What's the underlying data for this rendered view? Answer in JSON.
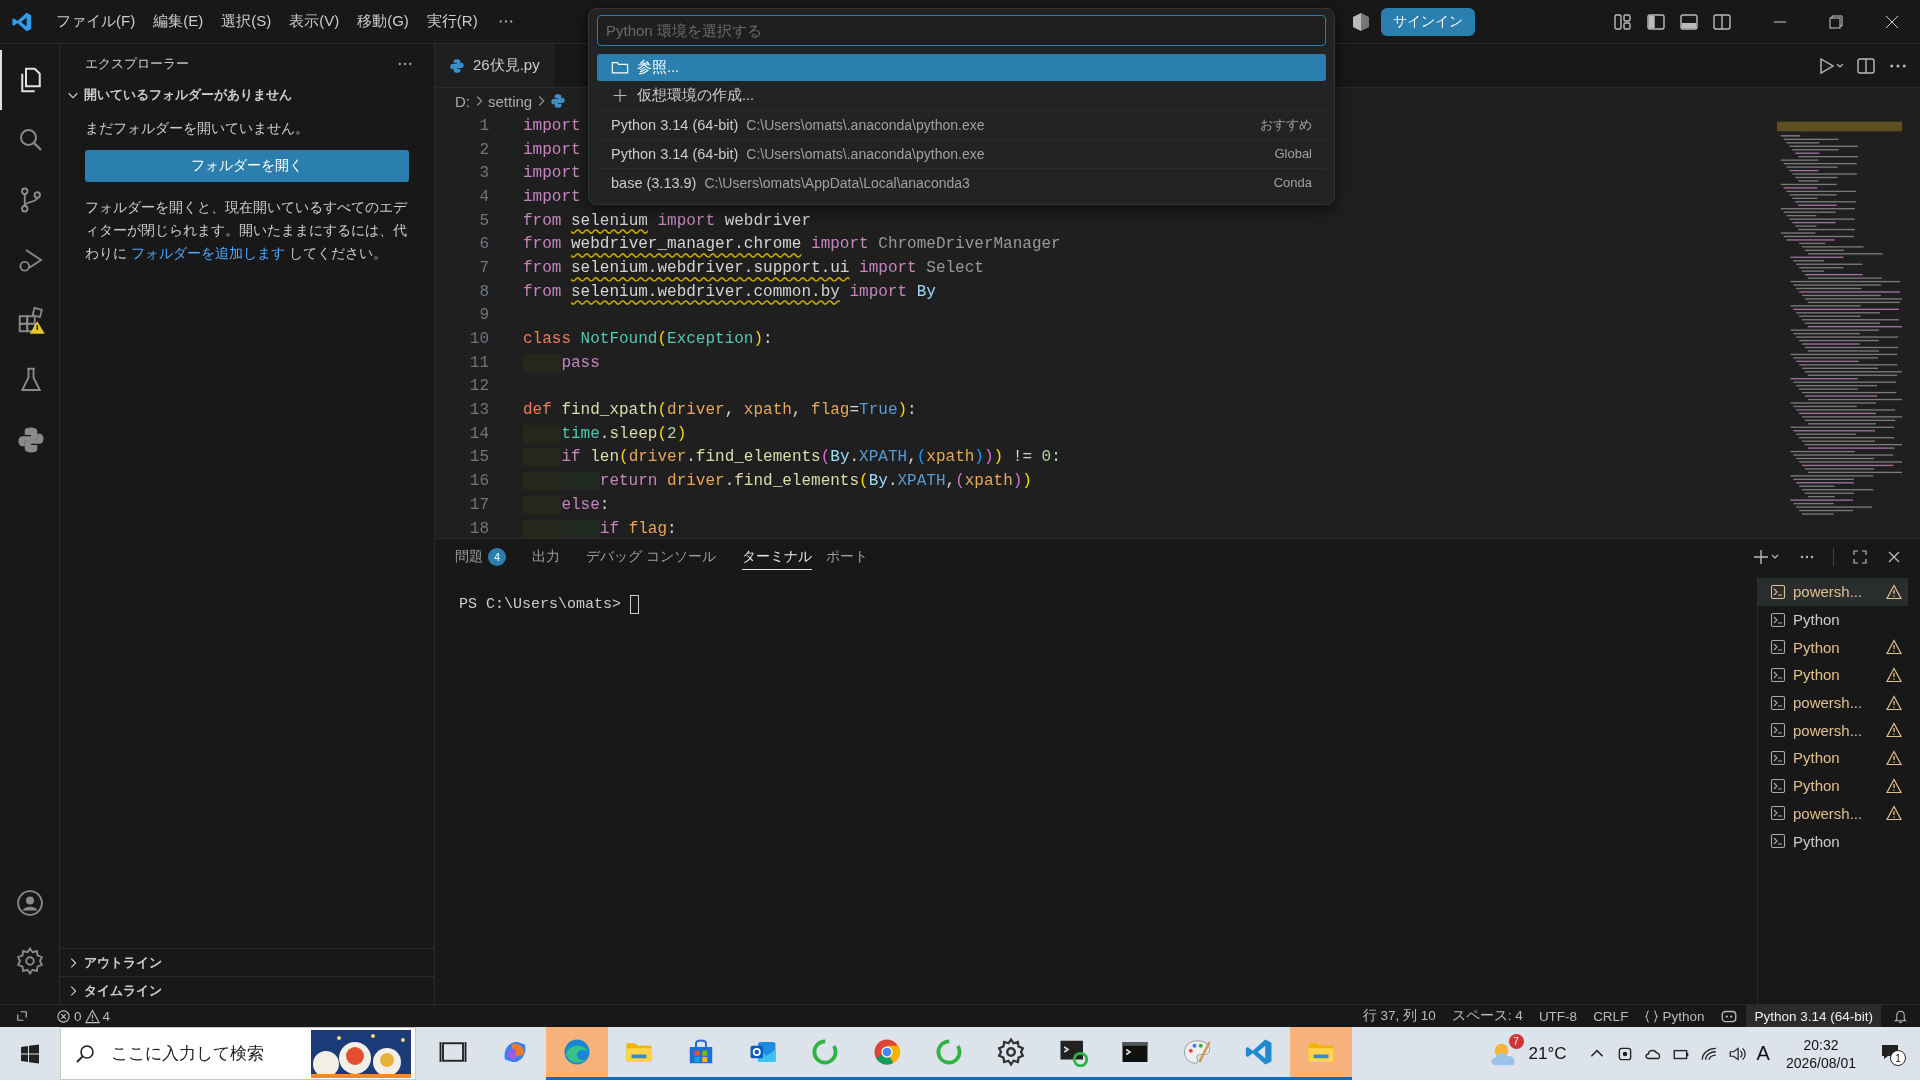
{
  "title_bar": {
    "menu": [
      "ファイル(F)",
      "編集(E)",
      "選択(S)",
      "表示(V)",
      "移動(G)",
      "実行(R)"
    ],
    "sign_in": "サインイン"
  },
  "quick_pick": {
    "placeholder": "Python 環境を選択する",
    "items": [
      {
        "kind": "browse",
        "label": "参照...",
        "selected": true
      },
      {
        "kind": "create",
        "label": "仮想環境の作成...",
        "selected": false
      },
      {
        "kind": "env",
        "label": "Python 3.14 (64-bit)",
        "detail": "C:\\Users\\omats\\.anaconda\\python.exe",
        "tag": "おすすめ",
        "selected": false
      },
      {
        "kind": "env",
        "label": "Python 3.14 (64-bit)",
        "detail": "C:\\Users\\omats\\.anaconda\\python.exe",
        "tag": "Global",
        "selected": false
      },
      {
        "kind": "env",
        "label": "base (3.13.9)",
        "detail": "C:\\Users\\omats\\AppData\\Local\\anaconda3",
        "tag": "Conda",
        "selected": false
      }
    ]
  },
  "activity_bar": [
    {
      "kind": "files",
      "selected": true
    },
    {
      "kind": "search",
      "selected": false
    },
    {
      "kind": "source",
      "selected": false
    },
    {
      "kind": "debug",
      "selected": false
    },
    {
      "kind": "extensions",
      "selected": false
    },
    {
      "kind": "testing",
      "selected": false
    },
    {
      "kind": "python",
      "selected": false
    }
  ],
  "sidebar": {
    "title": "エクスプローラー",
    "section": {
      "label": "開いているフォルダーがありません",
      "expanded": true
    },
    "message": "まだフォルダーを開いていません。",
    "button": "フォルダーを開く",
    "note_before": "フォルダーを開くと、現在開いているすべてのエディターが閉じられます。開いたままにするには、代わりに ",
    "note_link": "フォルダーを追加します",
    "note_after": " してください。",
    "bottom_sections": [
      {
        "label": "アウトライン",
        "expanded": false
      },
      {
        "label": "タイムライン",
        "expanded": false
      }
    ]
  },
  "editor": {
    "tab": "26伏見.py",
    "breadcrumb": [
      "D:",
      "setting"
    ],
    "lines": [
      {
        "n": "1",
        "tokens": [
          {
            "text": "import",
            "kind": "kw"
          }
        ]
      },
      {
        "n": "2",
        "tokens": [
          {
            "text": "import",
            "kind": "kw"
          }
        ]
      },
      {
        "n": "3",
        "tokens": [
          {
            "text": "import",
            "kind": "kw"
          }
        ]
      },
      {
        "n": "4",
        "tokens": [
          {
            "text": "import",
            "kind": "kw"
          }
        ]
      },
      {
        "n": "5",
        "tokens": [
          {
            "text": "from ",
            "kind": "kw"
          },
          {
            "text": "selenium",
            "kind": "warnmod"
          },
          {
            "text": " import",
            "kind": "kw"
          },
          {
            "text": " webdriver",
            "kind": "plain"
          }
        ]
      },
      {
        "n": "6",
        "tokens": [
          {
            "text": "from ",
            "kind": "kw"
          },
          {
            "text": "webdriver_manager.chrome",
            "kind": "warnmod"
          },
          {
            "text": " import",
            "kind": "kw"
          },
          {
            "text": " ChromeDriverManager",
            "kind": "dim"
          }
        ]
      },
      {
        "n": "7",
        "tokens": [
          {
            "text": "from ",
            "kind": "kw"
          },
          {
            "text": "selenium.webdriver.support.ui",
            "kind": "warnmod"
          },
          {
            "text": " import",
            "kind": "kw"
          },
          {
            "text": " Select",
            "kind": "dim"
          }
        ]
      },
      {
        "n": "8",
        "tokens": [
          {
            "text": "from ",
            "kind": "kw"
          },
          {
            "text": "selenium.webdriver.common.by",
            "kind": "warnmod"
          },
          {
            "text": " import",
            "kind": "kw"
          },
          {
            "text": " By",
            "kind": "var"
          }
        ]
      },
      {
        "n": "9"
      },
      {
        "n": "10",
        "tokens": [
          {
            "text": "class ",
            "kind": "decl"
          },
          {
            "text": "NotFound",
            "kind": "cls"
          },
          {
            "text": "(",
            "kind": "b1"
          },
          {
            "text": "Exception",
            "kind": "cls"
          },
          {
            "text": ")",
            "kind": "b1"
          },
          {
            "text": ":",
            "kind": "plain"
          }
        ]
      },
      {
        "n": "11",
        "tokens": [
          {
            "text": "    pass",
            "kind": "kw"
          }
        ]
      },
      {
        "n": "12"
      },
      {
        "n": "13",
        "tokens": [
          {
            "text": "def ",
            "kind": "decl"
          },
          {
            "text": "find_xpath",
            "kind": "fn"
          },
          {
            "text": "(",
            "kind": "b1"
          },
          {
            "text": "driver",
            "kind": "param"
          },
          {
            "text": ", ",
            "kind": "plain"
          },
          {
            "text": "xpath",
            "kind": "param"
          },
          {
            "text": ", ",
            "kind": "plain"
          },
          {
            "text": "flag",
            "kind": "param"
          },
          {
            "text": "=",
            "kind": "plain"
          },
          {
            "text": "True",
            "kind": "const"
          },
          {
            "text": ")",
            "kind": "b1"
          },
          {
            "text": ":",
            "kind": "plain"
          }
        ]
      },
      {
        "n": "14",
        "tokens": [
          {
            "text": "    time",
            "kind": "cls"
          },
          {
            "text": ".",
            "kind": "plain"
          },
          {
            "text": "sleep",
            "kind": "fn"
          },
          {
            "text": "(",
            "kind": "b1"
          },
          {
            "text": "2",
            "kind": "num"
          },
          {
            "text": ")",
            "kind": "b1"
          }
        ]
      },
      {
        "n": "15",
        "tokens": [
          {
            "text": "    if ",
            "kind": "kw"
          },
          {
            "text": "len",
            "kind": "fn"
          },
          {
            "text": "(",
            "kind": "b1"
          },
          {
            "text": "driver",
            "kind": "param"
          },
          {
            "text": ".",
            "kind": "plain"
          },
          {
            "text": "find_elements",
            "kind": "fn"
          },
          {
            "text": "(",
            "kind": "b2"
          },
          {
            "text": "By",
            "kind": "var"
          },
          {
            "text": ".",
            "kind": "plain"
          },
          {
            "text": "XPATH",
            "kind": "const"
          },
          {
            "text": ",",
            "kind": "plain"
          },
          {
            "text": "(",
            "kind": "b3"
          },
          {
            "text": "xpath",
            "kind": "param"
          },
          {
            "text": ")",
            "kind": "b3"
          },
          {
            "text": ")",
            "kind": "b2"
          },
          {
            "text": ")",
            "kind": "b1"
          },
          {
            "text": " != ",
            "kind": "plain"
          },
          {
            "text": "0",
            "kind": "num"
          },
          {
            "text": ":",
            "kind": "plain"
          }
        ]
      },
      {
        "n": "16",
        "tokens": [
          {
            "text": "        return ",
            "kind": "kw"
          },
          {
            "text": "driver",
            "kind": "param"
          },
          {
            "text": ".",
            "kind": "plain"
          },
          {
            "text": "find_elements",
            "kind": "fn"
          },
          {
            "text": "(",
            "kind": "b1"
          },
          {
            "text": "By",
            "kind": "var"
          },
          {
            "text": ".",
            "kind": "plain"
          },
          {
            "text": "XPATH",
            "kind": "const"
          },
          {
            "text": ",",
            "kind": "plain"
          },
          {
            "text": "(",
            "kind": "b2"
          },
          {
            "text": "xpath",
            "kind": "param"
          },
          {
            "text": ")",
            "kind": "b2"
          },
          {
            "text": ")",
            "kind": "b1"
          }
        ]
      },
      {
        "n": "17",
        "tokens": [
          {
            "text": "    else",
            "kind": "kw"
          },
          {
            "text": ":",
            "kind": "plain"
          }
        ]
      },
      {
        "n": "18",
        "tokens": [
          {
            "text": "        if ",
            "kind": "kw"
          },
          {
            "text": "flag",
            "kind": "param"
          },
          {
            "text": ":",
            "kind": "plain"
          }
        ]
      }
    ]
  },
  "panel": {
    "tabs": [
      {
        "label": "問題",
        "badge": "4",
        "selected": false
      },
      {
        "label": "出力",
        "selected": false
      },
      {
        "label": "デバッグ コンソール",
        "selected": false
      },
      {
        "label": "ターミナル",
        "selected": true
      },
      {
        "label": "ポート",
        "selected": false
      }
    ],
    "prompt": "PS C:\\Users\\omats> ",
    "terminals": [
      {
        "name": "powersh...",
        "warning": true,
        "selected": true
      },
      {
        "name": "Python",
        "warning": false,
        "selected": false
      },
      {
        "name": "Python",
        "warning": true,
        "selected": false
      },
      {
        "name": "Python",
        "warning": true,
        "selected": false
      },
      {
        "name": "powersh...",
        "warning": true,
        "selected": false
      },
      {
        "name": "powersh...",
        "warning": true,
        "selected": false
      },
      {
        "name": "Python",
        "warning": true,
        "selected": false
      },
      {
        "name": "Python",
        "warning": true,
        "selected": false
      },
      {
        "name": "powersh...",
        "warning": true,
        "selected": false
      },
      {
        "name": "Python",
        "warning": false,
        "selected": false
      }
    ]
  },
  "status_bar": {
    "errors": "0",
    "warnings": "4",
    "position": "行 37, 列 10",
    "spaces": "スペース: 4",
    "encoding": "UTF-8",
    "eol": "CRLF",
    "language": "Python",
    "interpreter": "Python 3.14 (64-bit)"
  },
  "taskbar": {
    "search_placeholder": "ここに入力して検索",
    "apps": [
      {
        "kind": "taskview",
        "running": false,
        "flashing": false
      },
      {
        "kind": "copilot",
        "running": false,
        "flashing": false
      },
      {
        "kind": "edge",
        "running": true,
        "flashing": true
      },
      {
        "kind": "folder",
        "running": true,
        "flashing": false
      },
      {
        "kind": "store",
        "running": true,
        "flashing": false
      },
      {
        "kind": "outlook",
        "running": true,
        "flashing": false
      },
      {
        "kind": "ring",
        "running": true,
        "flashing": false
      },
      {
        "kind": "chrome",
        "running": true,
        "flashing": false
      },
      {
        "kind": "ring",
        "running": true,
        "flashing": false
      },
      {
        "kind": "gear",
        "running": true,
        "flashing": false
      },
      {
        "kind": "cmd",
        "running": true,
        "flashing": false
      },
      {
        "kind": "terminal",
        "running": true,
        "flashing": false
      },
      {
        "kind": "paint",
        "running": true,
        "flashing": false
      },
      {
        "kind": "vscode",
        "running": true,
        "flashing": false
      },
      {
        "kind": "folder",
        "running": true,
        "flashing": true
      }
    ],
    "weather_badge": "7",
    "temperature": "21°C",
    "ime": "A",
    "time": "20:32",
    "date": "2026/08/01",
    "notifications": "1"
  }
}
